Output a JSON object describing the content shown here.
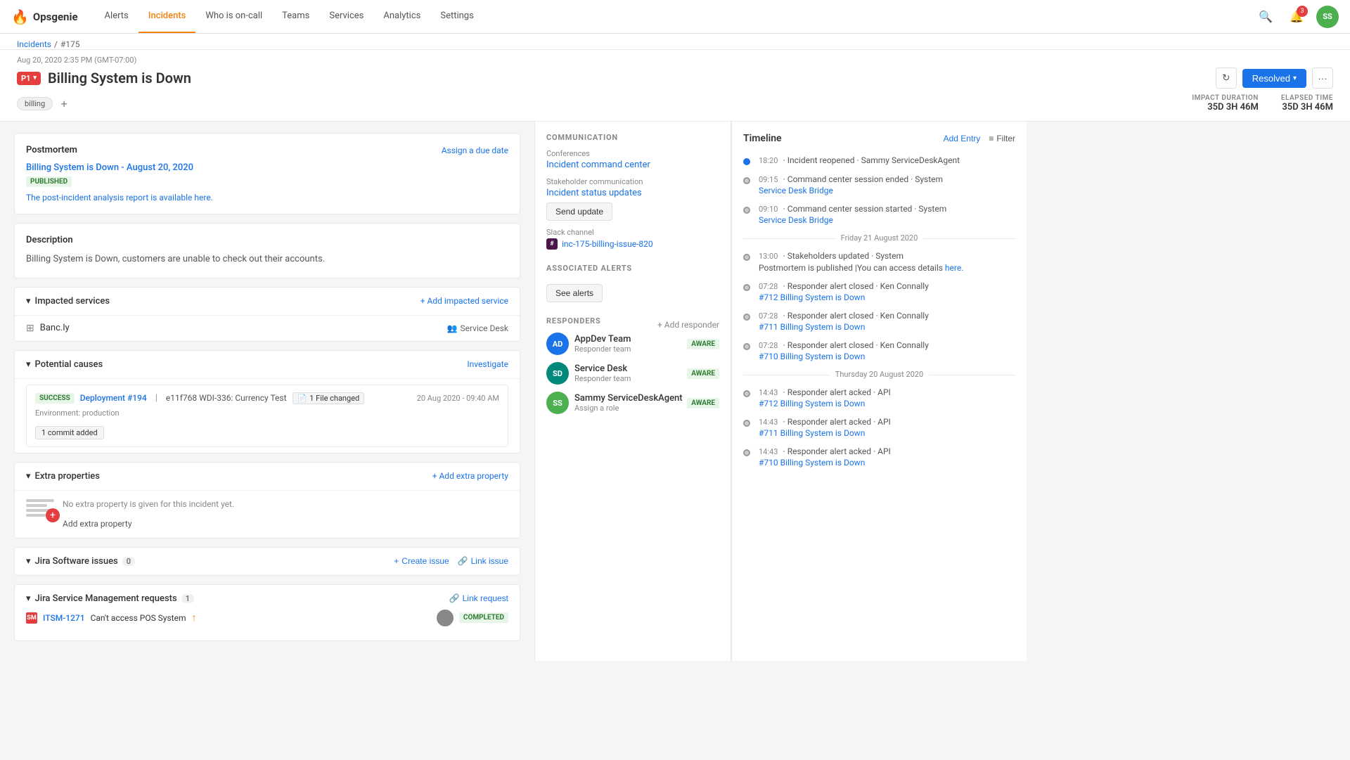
{
  "app": {
    "logo": "🔥",
    "name": "Opsgenie"
  },
  "nav": {
    "items": [
      {
        "label": "Alerts",
        "active": false
      },
      {
        "label": "Incidents",
        "active": true
      },
      {
        "label": "Who is on-call",
        "active": false
      },
      {
        "label": "Teams",
        "active": false
      },
      {
        "label": "Services",
        "active": false
      },
      {
        "label": "Analytics",
        "active": false
      },
      {
        "label": "Settings",
        "active": false
      }
    ],
    "notification_count": "3",
    "user_initials": "SS"
  },
  "breadcrumb": {
    "parent": "Incidents",
    "current": "#175"
  },
  "incident": {
    "priority": "P1",
    "date": "Aug 20, 2020 2:35 PM (GMT-07:00)",
    "title": "Billing System is Down",
    "tag": "billing",
    "status": "Resolved",
    "impact_duration_label": "IMPACT DURATION",
    "impact_duration_value": "35D 3H 46M",
    "elapsed_time_label": "ELAPSED TIME",
    "elapsed_time_value": "35D 3H 46M"
  },
  "postmortem": {
    "section_title": "Postmortem",
    "due_date_label": "Assign a due date",
    "title": "Billing System is Down - August 20, 2020",
    "status": "PUBLISHED",
    "link_text": "The post-incident analysis report is available here."
  },
  "description": {
    "title": "Description",
    "text": "Billing System is Down, customers are unable to check out their accounts."
  },
  "impacted_services": {
    "title": "Impacted services",
    "add_label": "+ Add impacted service",
    "services": [
      {
        "name": "Banc.ly",
        "team": "Service Desk"
      }
    ]
  },
  "potential_causes": {
    "title": "Potential causes",
    "investigate_label": "Investigate",
    "cause": {
      "status": "SUCCESS",
      "deployment_num": "Deployment #194",
      "description": "e11f768 WDI-336: Currency Test",
      "environment": "Environment: production",
      "files_changed": "1  File changed",
      "date": "20 Aug 2020 - 09:40 AM",
      "commit": "1 commit added"
    }
  },
  "extra_properties": {
    "title": "Extra properties",
    "add_label": "+ Add extra property",
    "placeholder": "No extra property is given for this incident yet.",
    "add_btn_label": "Add extra property"
  },
  "jira_issues": {
    "title": "Jira Software issues",
    "count": "0",
    "create_label": "Create issue",
    "link_label": "Link issue"
  },
  "jira_service": {
    "title": "Jira Service Management requests",
    "count": "1",
    "link_label": "Link request",
    "requests": [
      {
        "key": "ITSM-1271",
        "summary": "Can't access POS System",
        "status": "COMPLETED",
        "priority_up": true
      }
    ]
  },
  "communication": {
    "title": "COMMUNICATION",
    "conferences_label": "Conferences",
    "conference_link": "Incident command center",
    "stakeholder_label": "Stakeholder communication",
    "stakeholder_link": "Incident status updates",
    "send_update_label": "Send update",
    "slack_label": "Slack channel",
    "slack_channel": "inc-175-billing-issue-820"
  },
  "associated_alerts": {
    "title": "ASSOCIATED ALERTS",
    "see_alerts_label": "See alerts"
  },
  "responders": {
    "title": "RESPONDERS",
    "add_label": "+ Add responder",
    "items": [
      {
        "name": "AppDev Team",
        "role": "Responder team",
        "status": "AWARE",
        "initials": "AD",
        "color": "avatar-blue"
      },
      {
        "name": "Service Desk",
        "role": "Responder team",
        "status": "AWARE",
        "initials": "SD",
        "color": "avatar-teal"
      },
      {
        "name": "Sammy ServiceDeskAgent",
        "role": "Assign a role",
        "status": "AWARE",
        "initials": "SS",
        "color": "avatar-green"
      }
    ]
  },
  "timeline": {
    "title": "Timeline",
    "add_entry_label": "Add Entry",
    "filter_label": "Filter",
    "items": [
      {
        "time": "18:20",
        "desc": "· Incident reopened · Sammy ServiceDeskAgent",
        "link": null,
        "dot": "active"
      },
      {
        "time": "09:15",
        "desc": "· Command center session ended · System",
        "link": "Service Desk Bridge",
        "dot": "normal"
      },
      {
        "time": "09:10",
        "desc": "· Command center session started · System",
        "link": "Service Desk Bridge",
        "dot": "normal"
      },
      {
        "divider": "Friday 21 August 2020"
      },
      {
        "time": "13:00",
        "desc": "· Stakeholders updated · System",
        "link": null,
        "dot": "normal",
        "extra": "Postmortem is published |You can access details",
        "extra_link": "here."
      },
      {
        "time": "07:28",
        "desc": "· Responder alert closed · Ken Connally",
        "link": "#712 Billing System is Down",
        "dot": "normal"
      },
      {
        "time": "07:28",
        "desc": "· Responder alert closed · Ken Connally",
        "link": "#711 Billing System is Down",
        "dot": "normal"
      },
      {
        "time": "07:28",
        "desc": "· Responder alert closed · Ken Connally",
        "link": "#710 Billing System is Down",
        "dot": "normal"
      },
      {
        "divider": "Thursday 20 August 2020"
      },
      {
        "time": "14:43",
        "desc": "· Responder alert acked · API",
        "link": "#712 Billing System is Down",
        "dot": "normal"
      },
      {
        "time": "14:43",
        "desc": "· Responder alert acked · API",
        "link": "#711 Billing System is Down",
        "dot": "normal"
      },
      {
        "time": "14:43",
        "desc": "· Responder alert acked · API",
        "link": "#710 Billing System is Down",
        "dot": "normal"
      }
    ]
  }
}
